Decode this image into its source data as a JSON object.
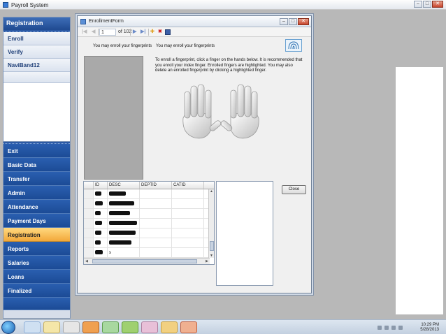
{
  "window": {
    "title": "Payroll System"
  },
  "leftnav": {
    "header": "Registration",
    "sub_items": [
      "Enroll",
      "Verify",
      "NaviBand12"
    ],
    "menu": [
      "Exit",
      "Basic Data",
      "Transfer",
      "Admin",
      "Attendance",
      "Payment Days",
      "Registration",
      "Reports",
      "Salaries",
      "Loans",
      "Finalized"
    ],
    "active": "Registration"
  },
  "form": {
    "title": "EnrollmentForm",
    "navigator": {
      "position": "1",
      "count": "of 102"
    },
    "msg_left": "You may enroll your fingerprints",
    "msg_right": "You may enroll your fingerprints",
    "instructions": "To enroll a fingerprint, click a finger on the hands below. It is recommended that you enroll your index finger. Enrolled fingers are highlighted. You may also delete an enrolled fingerprint by clicking a highlighted finger.",
    "grid": {
      "headers": [
        "ID",
        "DESC",
        "DEPTID",
        "CATID"
      ],
      "visible_desc": [
        "s"
      ]
    },
    "close_label": "Close"
  },
  "taskbar": {
    "clock_time": "10:29 PM",
    "clock_date": "5/28/2013"
  },
  "colors": {
    "nav_blue": "#1f4a91",
    "active_orange": "#f3a83a"
  }
}
